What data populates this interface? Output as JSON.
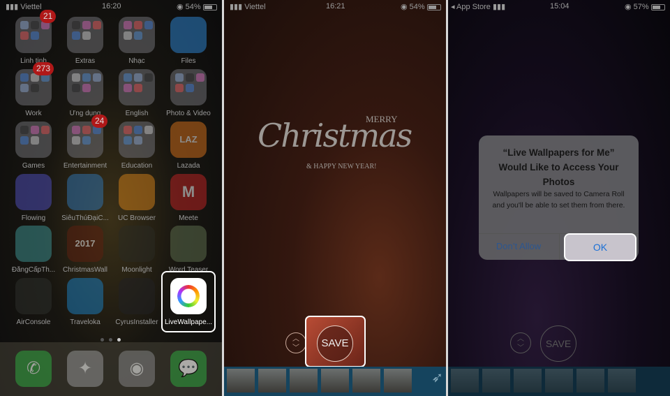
{
  "panel1": {
    "status": {
      "carrier": "Viettel",
      "time": "16:20",
      "battery": "54%"
    },
    "apps": [
      {
        "label": "Linh tinh",
        "badge": "21",
        "folder": true
      },
      {
        "label": "Extras",
        "folder": true
      },
      {
        "label": "Nhạc",
        "folder": true
      },
      {
        "label": "Files",
        "color": "#2c7fc8"
      },
      {
        "label": "Work",
        "badge": "273",
        "folder": true
      },
      {
        "label": "Ứng dụng",
        "folder": true
      },
      {
        "label": "English",
        "folder": true
      },
      {
        "label": "Photo & Video",
        "folder": true
      },
      {
        "label": "Games",
        "folder": true
      },
      {
        "label": "Entertainment",
        "badge": "24",
        "folder": true
      },
      {
        "label": "Education",
        "folder": true
      },
      {
        "label": "Lazada",
        "color": "#c86a1a",
        "glyph": "LAZ"
      },
      {
        "label": "Flowing",
        "color": "#4a4ab0"
      },
      {
        "label": "SiêuThúĐạiC...",
        "color": "#2f6fa8"
      },
      {
        "label": "UC Browser",
        "color": "#c77a1a"
      },
      {
        "label": "Meete",
        "color": "#b42222",
        "glyph": "M"
      },
      {
        "label": "ĐẳngCấpTh...",
        "color": "#3a8a8a"
      },
      {
        "label": "ChristmasWall",
        "color": "#5a2010",
        "glyph": "2017"
      },
      {
        "label": "Moonlight",
        "color": "#2a2a22"
      },
      {
        "label": "Word Teaser",
        "color": "#5a6a4a"
      },
      {
        "label": "AirConsole",
        "color": "#2c2e2a"
      },
      {
        "label": "Traveloka",
        "color": "#1b79b5"
      },
      {
        "label": "CyrusInstaller",
        "color": "#202022"
      },
      {
        "label": "LiveWallpape...",
        "color": "#ffffff",
        "highlighted": true
      }
    ],
    "dock": [
      {
        "name": "phone",
        "color": "#2e9a3c"
      },
      {
        "name": "safari",
        "color": "#8a8a8a"
      },
      {
        "name": "camera",
        "color": "#7a7a7a"
      },
      {
        "name": "messages",
        "color": "#2e9a3c"
      }
    ]
  },
  "panel2": {
    "status": {
      "carrier": "Viettel",
      "time": "16:21",
      "battery": "54%"
    },
    "wallpaper": {
      "merry": "MERRY",
      "script": "Christmas",
      "tagline": "& HAPPY NEW YEAR!"
    },
    "save_label": "SAVE"
  },
  "panel3": {
    "status": {
      "back": "App Store",
      "time": "15:04",
      "battery": "57%"
    },
    "dialog": {
      "title": "“Live Wallpapers for Me” Would Like to Access Your Photos",
      "message": "Wallpapers will be saved to Camera Roll and you'll be able to set them from there.",
      "deny": "Don’t Allow",
      "ok": "OK"
    },
    "save_label": "SAVE"
  },
  "colors": {
    "ios_blue": "#1a6fd6",
    "badge_red": "#b01818",
    "highlight": "#ffffff"
  }
}
